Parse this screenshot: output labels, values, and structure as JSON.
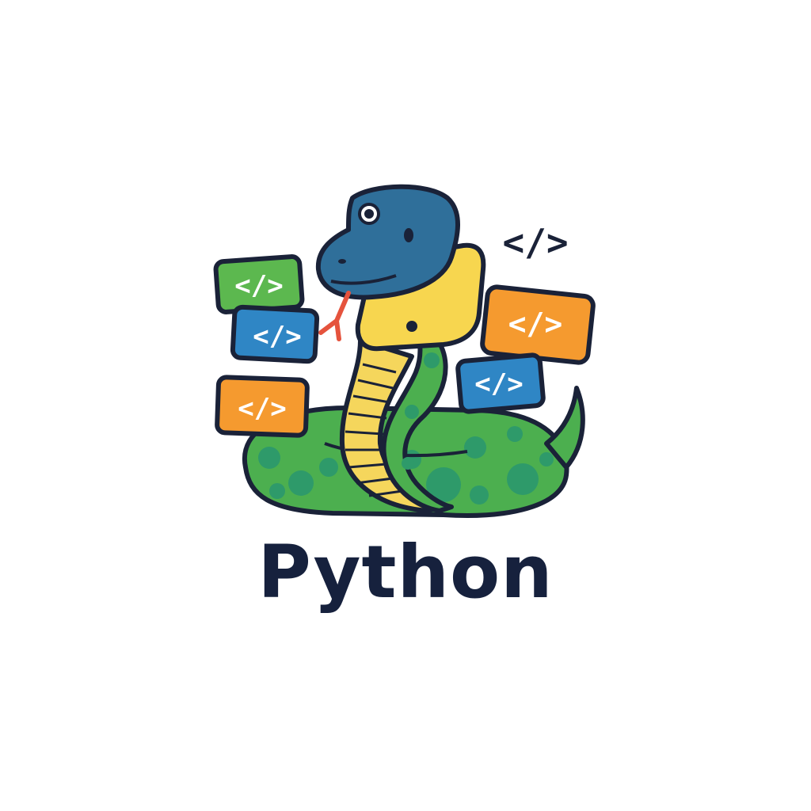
{
  "logo": {
    "title": "Python",
    "code_symbol": "</>",
    "colors": {
      "background": "#ffffff",
      "title_text": "#16213d",
      "snake_head": "#2f6f9a",
      "snake_head_yellow": "#f7d64f",
      "snake_body": "#4caf4f",
      "snake_spots": "#2e9a6a",
      "snake_belly": "#f5d65c",
      "tongue": "#e5533d",
      "tag_green": "#5cb84f",
      "tag_blue": "#2f86c5",
      "tag_orange": "#f59a2f",
      "outline": "#1a2238"
    },
    "tags": [
      {
        "color_name": "green",
        "text": "</>"
      },
      {
        "color_name": "blue",
        "text": "</>"
      },
      {
        "color_name": "orange",
        "text": "</>"
      },
      {
        "color_name": "orange",
        "text": "</>"
      },
      {
        "color_name": "blue",
        "text": "</>"
      }
    ],
    "floating_symbol": "</>"
  }
}
